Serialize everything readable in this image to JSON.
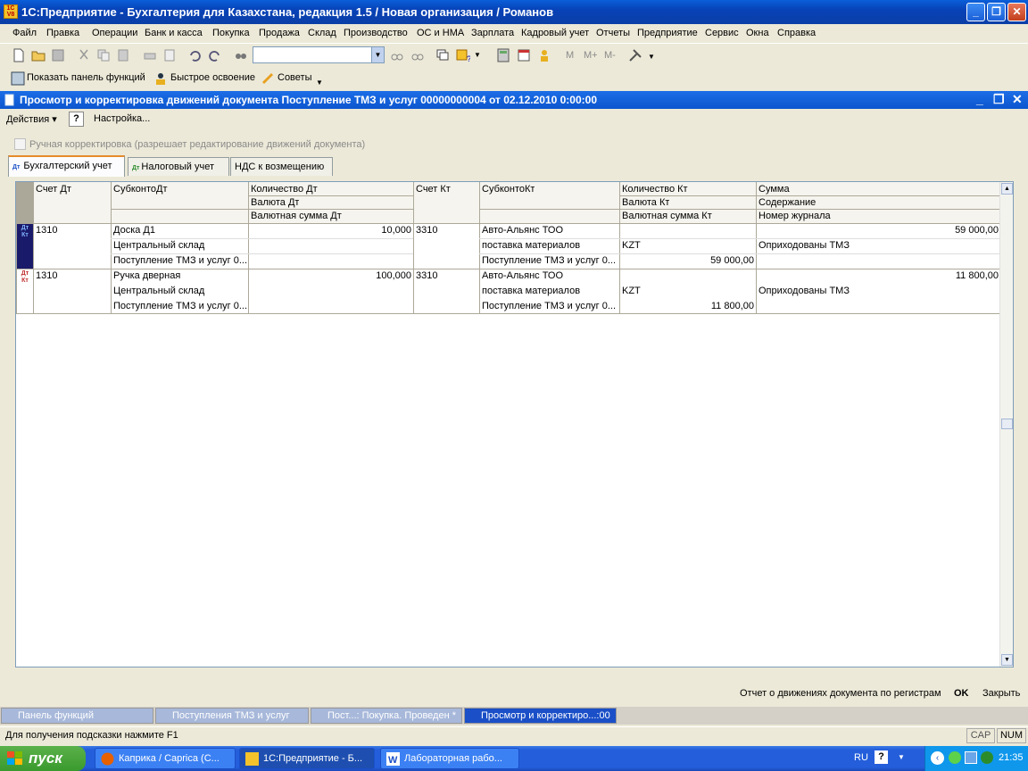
{
  "app": {
    "title": "1С:Предприятие - Бухгалтерия для Казахстана, редакция 1.5 / Новая организация / Романов",
    "logo_text": "1С V8"
  },
  "menu": [
    "Файл",
    "Правка",
    "Операции",
    "Банк и касса",
    "Покупка",
    "Продажа",
    "Склад",
    "Производство",
    "ОС и НМА",
    "Зарплата",
    "Кадровый учет",
    "Отчеты",
    "Предприятие",
    "Сервис",
    "Окна",
    "Справка"
  ],
  "toolbar": {
    "search_value": "",
    "memory_buttons": [
      "M",
      "M+",
      "M-"
    ]
  },
  "toolbar2": {
    "show_panel": "Показать панель функций",
    "quick_learn": "Быстрое освоение",
    "tips": "Советы"
  },
  "document": {
    "title": "Просмотр и корректировка движений документа Поступление ТМЗ и услуг 00000000004 от 02.12.2010 0:00:00",
    "actions_label": "Действия",
    "help_label": "?",
    "settings_label": "Настройка...",
    "manual_correction": "Ручная корректировка (разрешает редактирование движений документа)",
    "manual_correction_checked": false,
    "tabs": [
      "Бухгалтерский учет",
      "Налоговый учет",
      "НДС к возмещению"
    ],
    "active_tab": 0
  },
  "grid": {
    "headers": {
      "schet_dt": "Счет Дт",
      "subkonto_dt": "СубконтоДт",
      "kol_dt": "Количество Дт",
      "val_dt": "Валюта Дт",
      "valsum_dt": "Валютная сумма Дт",
      "schet_kt": "Счет Кт",
      "subkonto_kt": "СубконтоКт",
      "kol_kt": "Количество Кт",
      "val_kt": "Валюта Кт",
      "valsum_kt": "Валютная сумма Кт",
      "summa": "Сумма",
      "soderzhanie": "Содержание",
      "nomer": "Номер журнала"
    },
    "row_marker": "Дт Кт",
    "rows": [
      {
        "schet_dt": "1310",
        "sub_dt": [
          "Доска Д1",
          "Центральный склад",
          "Поступление ТМЗ и услуг 0..."
        ],
        "kol_dt": "10,000",
        "val_dt": "",
        "valsum_dt": "",
        "schet_kt": "3310",
        "sub_kt": [
          "Авто-Альянс ТОО",
          "поставка материалов",
          "Поступление ТМЗ и услуг 0..."
        ],
        "kol_kt": "",
        "val_kt": "KZT",
        "valsum_kt": "59 000,00",
        "summa": "59 000,00",
        "soderzhanie": "Оприходованы ТМЗ",
        "nomer": ""
      },
      {
        "schet_dt": "1310",
        "sub_dt": [
          "Ручка дверная",
          "Центральный склад",
          "Поступление ТМЗ и услуг 0..."
        ],
        "kol_dt": "100,000",
        "val_dt": "",
        "valsum_dt": "",
        "schet_kt": "3310",
        "sub_kt": [
          "Авто-Альянс ТОО",
          "поставка материалов",
          "Поступление ТМЗ и услуг 0..."
        ],
        "kol_kt": "",
        "val_kt": "KZT",
        "valsum_kt": "11 800,00",
        "summa": "11 800,00",
        "soderzhanie": "Оприходованы ТМЗ",
        "nomer": ""
      }
    ]
  },
  "footer": {
    "report": "Отчет о движениях документа по регистрам",
    "ok": "OK",
    "close": "Закрыть"
  },
  "window_tabs": [
    "Панель функций",
    "Поступления ТМЗ и услуг",
    "Пост...: Покупка. Проведен *",
    "Просмотр и корректиро...:00"
  ],
  "status": {
    "hint": "Для получения подсказки нажмите F1",
    "cap": "CAP",
    "num": "NUM"
  },
  "taskbar": {
    "start": "пуск",
    "tasks": [
      "Каприка / Caprica (С...",
      "1С:Предприятие - Б...",
      "Лабораторная рабо..."
    ],
    "lang": "RU",
    "clock": "21:35"
  },
  "colors": {
    "title_blue": "#0842b8",
    "doc_title_blue": "#0c56cf",
    "taskbar_blue": "#245edb",
    "start_green": "#3a9a2e",
    "tab_accent": "#e68b2c"
  }
}
